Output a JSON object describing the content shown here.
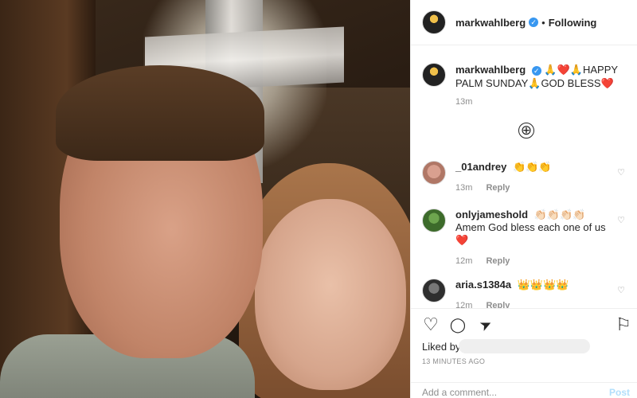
{
  "post": {
    "username": "markwahlberg",
    "verified_mark": "✓",
    "dot": "•",
    "follow_status": "Following"
  },
  "caption": {
    "username": "markwahlberg",
    "text": "🙏❤️🙏HAPPY PALM SUNDAY🙏GOD BLESS❤️",
    "time": "13m"
  },
  "more_comments_icon": "⊕",
  "comments": [
    {
      "username": "_01andrey",
      "text": "👏👏👏",
      "time": "13m",
      "reply_label": "Reply"
    },
    {
      "username": "onlyjameshold",
      "text": "👏🏻👏🏻👏🏻👏🏻 Amem God bless each one of us ❤️",
      "time": "12m",
      "reply_label": "Reply"
    },
    {
      "username": "aria.s1384a",
      "text": "👑👑👑👑",
      "time": "12m",
      "reply_label": "Reply"
    }
  ],
  "actions": {
    "like_icon": "♡",
    "comment_icon": "◯",
    "share_icon": "➤",
    "save_icon": "⚐"
  },
  "likes_label": "Liked by",
  "time_ago": "13 MINUTES AGO",
  "add_comment": {
    "placeholder": "Add a comment...",
    "post_label": "Post"
  },
  "colors": {
    "accent": "#3897f0",
    "post_disabled": "#b2dffc",
    "heart": "#ed4956"
  }
}
